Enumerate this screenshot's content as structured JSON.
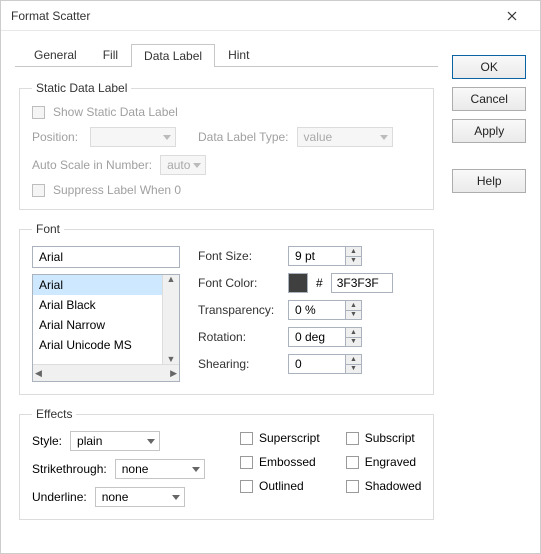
{
  "title": "Format Scatter",
  "buttons": {
    "ok": "OK",
    "cancel": "Cancel",
    "apply": "Apply",
    "help": "Help"
  },
  "tabs": {
    "general": "General",
    "fill": "Fill",
    "datalabel": "Data Label",
    "hint": "Hint"
  },
  "static": {
    "legend": "Static Data Label",
    "show": "Show Static Data Label",
    "position": "Position:",
    "type_label": "Data Label Type:",
    "type_value": "value",
    "autoscale": "Auto Scale in Number:",
    "autoscale_value": "auto",
    "suppress": "Suppress Label When 0"
  },
  "font": {
    "legend": "Font",
    "name_value": "Arial",
    "list": [
      "Arial",
      "Arial Black",
      "Arial Narrow",
      "Arial Unicode MS"
    ],
    "size_label": "Font Size:",
    "size_value": "9 pt",
    "color_label": "Font Color:",
    "color_hash": "#",
    "color_value": "3F3F3F",
    "transparency_label": "Transparency:",
    "transparency_value": "0 %",
    "rotation_label": "Rotation:",
    "rotation_value": "0 deg",
    "shearing_label": "Shearing:",
    "shearing_value": "0"
  },
  "effects": {
    "legend": "Effects",
    "style_label": "Style:",
    "style_value": "plain",
    "strike_label": "Strikethrough:",
    "strike_value": "none",
    "underline_label": "Underline:",
    "underline_value": "none",
    "superscript": "Superscript",
    "subscript": "Subscript",
    "embossed": "Embossed",
    "engraved": "Engraved",
    "outlined": "Outlined",
    "shadowed": "Shadowed"
  }
}
